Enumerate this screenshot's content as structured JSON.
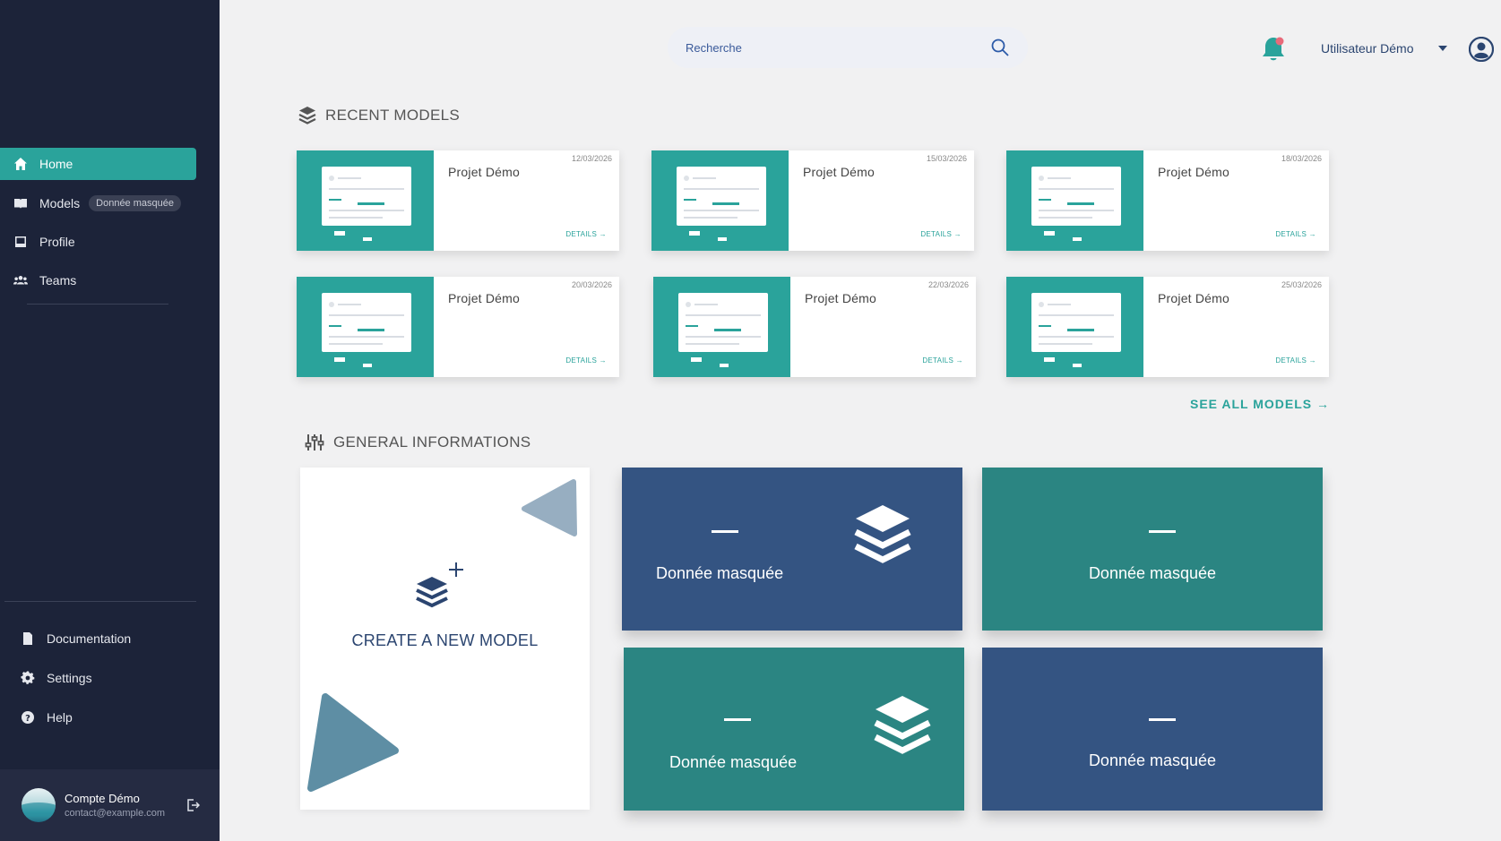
{
  "sidebar": {
    "items": [
      {
        "label": "Home",
        "icon": "home-icon"
      },
      {
        "label": "Models",
        "icon": "book-icon",
        "badge": "Donnée masquée"
      },
      {
        "label": "Profile",
        "icon": "profile-icon"
      },
      {
        "label": "Teams",
        "icon": "teams-icon"
      }
    ],
    "bottom_items": [
      {
        "label": "Documentation",
        "icon": "document-icon"
      },
      {
        "label": "Settings",
        "icon": "gear-icon"
      },
      {
        "label": "Help",
        "icon": "help-icon"
      }
    ],
    "account": {
      "name": "Compte Démo",
      "email": "contact@example.com"
    }
  },
  "header": {
    "search_placeholder": "Recherche",
    "user_name": "Utilisateur Démo"
  },
  "recent": {
    "title": "RECENT MODELS",
    "cards": [
      {
        "title": "Projet Démo",
        "date": "12/03/2026",
        "details": "DETAILS →"
      },
      {
        "title": "Projet Démo",
        "date": "15/03/2026",
        "details": "DETAILS →"
      },
      {
        "title": "Projet Démo",
        "date": "18/03/2026",
        "details": "DETAILS →"
      },
      {
        "title": "Projet Démo",
        "date": "20/03/2026",
        "details": "DETAILS →"
      },
      {
        "title": "Projet Démo",
        "date": "22/03/2026",
        "details": "DETAILS →"
      },
      {
        "title": "Projet Démo",
        "date": "25/03/2026",
        "details": "DETAILS →"
      }
    ],
    "see_all": "SEE ALL MODELS →"
  },
  "general": {
    "title": "GENERAL INFORMATIONS",
    "create_label": "CREATE A NEW MODEL",
    "stats": [
      {
        "value": "—",
        "label": "Donnée masquée"
      },
      {
        "value": "—",
        "label": "Donnée masquée"
      },
      {
        "value": "—",
        "label": "Donnée masquée"
      },
      {
        "value": "—",
        "label": "Donnée masquée"
      }
    ]
  },
  "colors": {
    "sidebar": "#1c2339",
    "accent": "#2aa39b",
    "blue": "#345482",
    "teal": "#2b8582",
    "notification": "#e86a7a"
  }
}
